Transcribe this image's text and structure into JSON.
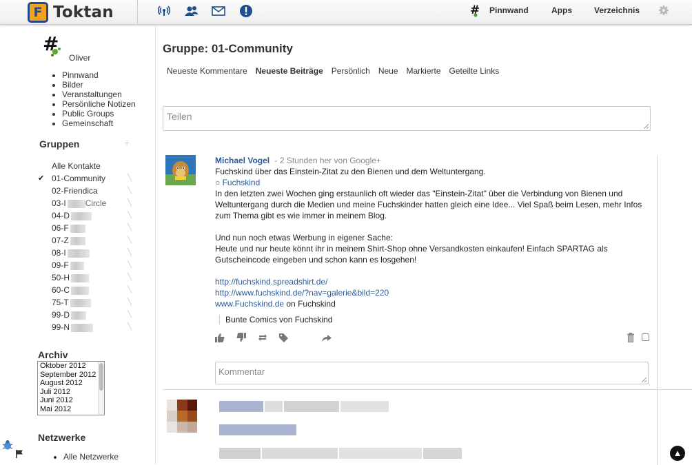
{
  "app": {
    "name": "Toktan",
    "logo_letter": "F"
  },
  "topnav": {
    "links": [
      {
        "label": "Pinnwand"
      },
      {
        "label": "Apps"
      },
      {
        "label": "Verzeichnis"
      }
    ],
    "icons": [
      "network-icon",
      "contacts-icon",
      "messages-icon",
      "notifications-icon",
      "settings-icon"
    ]
  },
  "sidebar": {
    "profile_name": "Oliver",
    "menu": [
      "Pinnwand",
      "Bilder",
      "Veranstaltungen",
      "Persönliche Notizen",
      "Public Groups",
      "Gemeinschaft"
    ],
    "groups_heading": "Gruppen",
    "groups_add": "+",
    "groups": [
      {
        "label": "Alle Kontakte",
        "selected": false
      },
      {
        "label": "01-Community",
        "selected": true
      },
      {
        "label": "02-Friendica",
        "selected": false
      },
      {
        "label": "03-I",
        "selected": false,
        "tail": "Circle"
      },
      {
        "label": "04-D",
        "selected": false
      },
      {
        "label": "06-F",
        "selected": false
      },
      {
        "label": "07-Z",
        "selected": false
      },
      {
        "label": "08-I",
        "selected": false
      },
      {
        "label": "09-F",
        "selected": false
      },
      {
        "label": "50-H",
        "selected": false
      },
      {
        "label": "60-C",
        "selected": false
      },
      {
        "label": "75-T",
        "selected": false
      },
      {
        "label": "99-D",
        "selected": false
      },
      {
        "label": "99-N",
        "selected": false
      }
    ],
    "archive_heading": "Archiv",
    "archive": [
      "Oktober 2012",
      "September 2012",
      "August 2012",
      "Juli 2012",
      "Juni 2012",
      "Mai 2012"
    ],
    "networks_heading": "Netzwerke",
    "networks": [
      "Alle Netzwerke"
    ]
  },
  "main": {
    "title": "Gruppe: 01-Community",
    "tabs": [
      {
        "label": "Neueste Kommentare",
        "active": false
      },
      {
        "label": "Neueste Beiträge",
        "active": true
      },
      {
        "label": "Persönlich",
        "active": false
      },
      {
        "label": "Neue",
        "active": false
      },
      {
        "label": "Markierte",
        "active": false
      },
      {
        "label": "Geteilte Links",
        "active": false
      }
    ],
    "share_placeholder": "Teilen",
    "post": {
      "author": "Michael Vogel",
      "meta": "- 2 Stunden her von Google+",
      "headline": "Fuchskind über das Einstein-Zitat zu den Bienen und dem Weltuntergang.",
      "link_title": "○ Fuchskind",
      "body_lines": [
        "In den letzten zwei Wochen ging erstaunlich oft wieder das \"Einstein-Zitat\" über die Verbindung von Bienen und",
        "Weltuntergang durch die Medien und meine Fuchskinder hatten gleich eine Idee... Viel Spaß beim Lesen, mehr Infos",
        "zum Thema gibt es wie immer in meinem Blog."
      ],
      "body2_lines": [
        "Und nun noch etwas Werbung in eigener Sache:",
        "Heute und nur heute könnt ihr in meinem Shirt-Shop ohne Versandkosten einkaufen! Einfach SPARTAG als",
        "Gutscheincode eingeben und schon kann es losgehen!"
      ],
      "links": [
        {
          "url": "http://fuchskind.spreadshirt.de/",
          "suffix": ""
        },
        {
          "url": "http://www.fuchskind.de/?nav=galerie&bild=220",
          "suffix": ""
        },
        {
          "url": "www.Fuchskind.de",
          "suffix": " on Fuchskind"
        }
      ],
      "quote": "Bunte Comics von Fuchskind",
      "comment_placeholder": "Kommentar"
    }
  },
  "colors": {
    "accent": "#2a5a9a",
    "logo_orange": "#f4a21e",
    "logo_blue": "#1f4c8c"
  }
}
